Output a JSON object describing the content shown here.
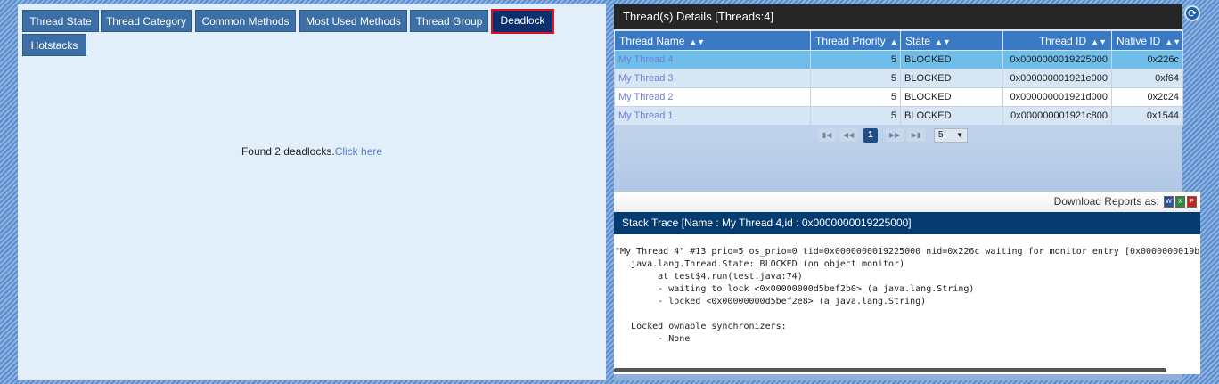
{
  "tabs": [
    {
      "label": "Thread State"
    },
    {
      "label": "Thread Category"
    },
    {
      "label": "Common Methods"
    },
    {
      "label": "Most Used Methods"
    },
    {
      "label": "Thread Group"
    },
    {
      "label": "Deadlock"
    },
    {
      "label": "Hotstacks"
    }
  ],
  "active_tab": "Deadlock",
  "deadlock": {
    "text": "Found 2 deadlocks.",
    "link": "Click here"
  },
  "details": {
    "title": "Thread(s) Details [Threads:4]",
    "columns": [
      "Thread Name",
      "Thread Priority",
      "State",
      "Thread ID",
      "Native ID"
    ],
    "rows": [
      {
        "name": "My Thread 4",
        "priority": "5",
        "state": "BLOCKED",
        "thread_id": "0x0000000019225000",
        "native_id": "0x226c"
      },
      {
        "name": "My Thread 3",
        "priority": "5",
        "state": "BLOCKED",
        "thread_id": "0x000000001921e000",
        "native_id": "0xf64"
      },
      {
        "name": "My Thread 2",
        "priority": "5",
        "state": "BLOCKED",
        "thread_id": "0x000000001921d000",
        "native_id": "0x2c24"
      },
      {
        "name": "My Thread 1",
        "priority": "5",
        "state": "BLOCKED",
        "thread_id": "0x000000001921c800",
        "native_id": "0x1544"
      }
    ],
    "selected_row": 0
  },
  "pager": {
    "current_page": "1",
    "per_page": "5"
  },
  "download": {
    "label": "Download Reports as:",
    "formats": [
      "word-icon",
      "excel-icon",
      "pdf-icon"
    ]
  },
  "stack_trace": {
    "title": "Stack Trace [Name : My Thread 4,id : 0x0000000019225000]",
    "lines": [
      "\"My Thread 4\" #13 prio=5 os_prio=0 tid=0x0000000019225000 nid=0x226c waiting for monitor entry [0x0000000019b",
      "   java.lang.Thread.State: BLOCKED (on object monitor)",
      "        at test$4.run(test.java:74)",
      "        - waiting to lock <0x00000000d5bef2b0> (a java.lang.String)",
      "        - locked <0x00000000d5bef2e8> (a java.lang.String)",
      "",
      "   Locked ownable synchronizers:",
      "        - None"
    ]
  },
  "colors": {
    "tab_bg": "#3b6fa6",
    "tab_active_bg": "#0c2f6e",
    "tab_active_border": "#e0101e",
    "table_header": "#3a7ac4",
    "selected_row": "#6fbde9",
    "stack_header": "#043c72"
  }
}
